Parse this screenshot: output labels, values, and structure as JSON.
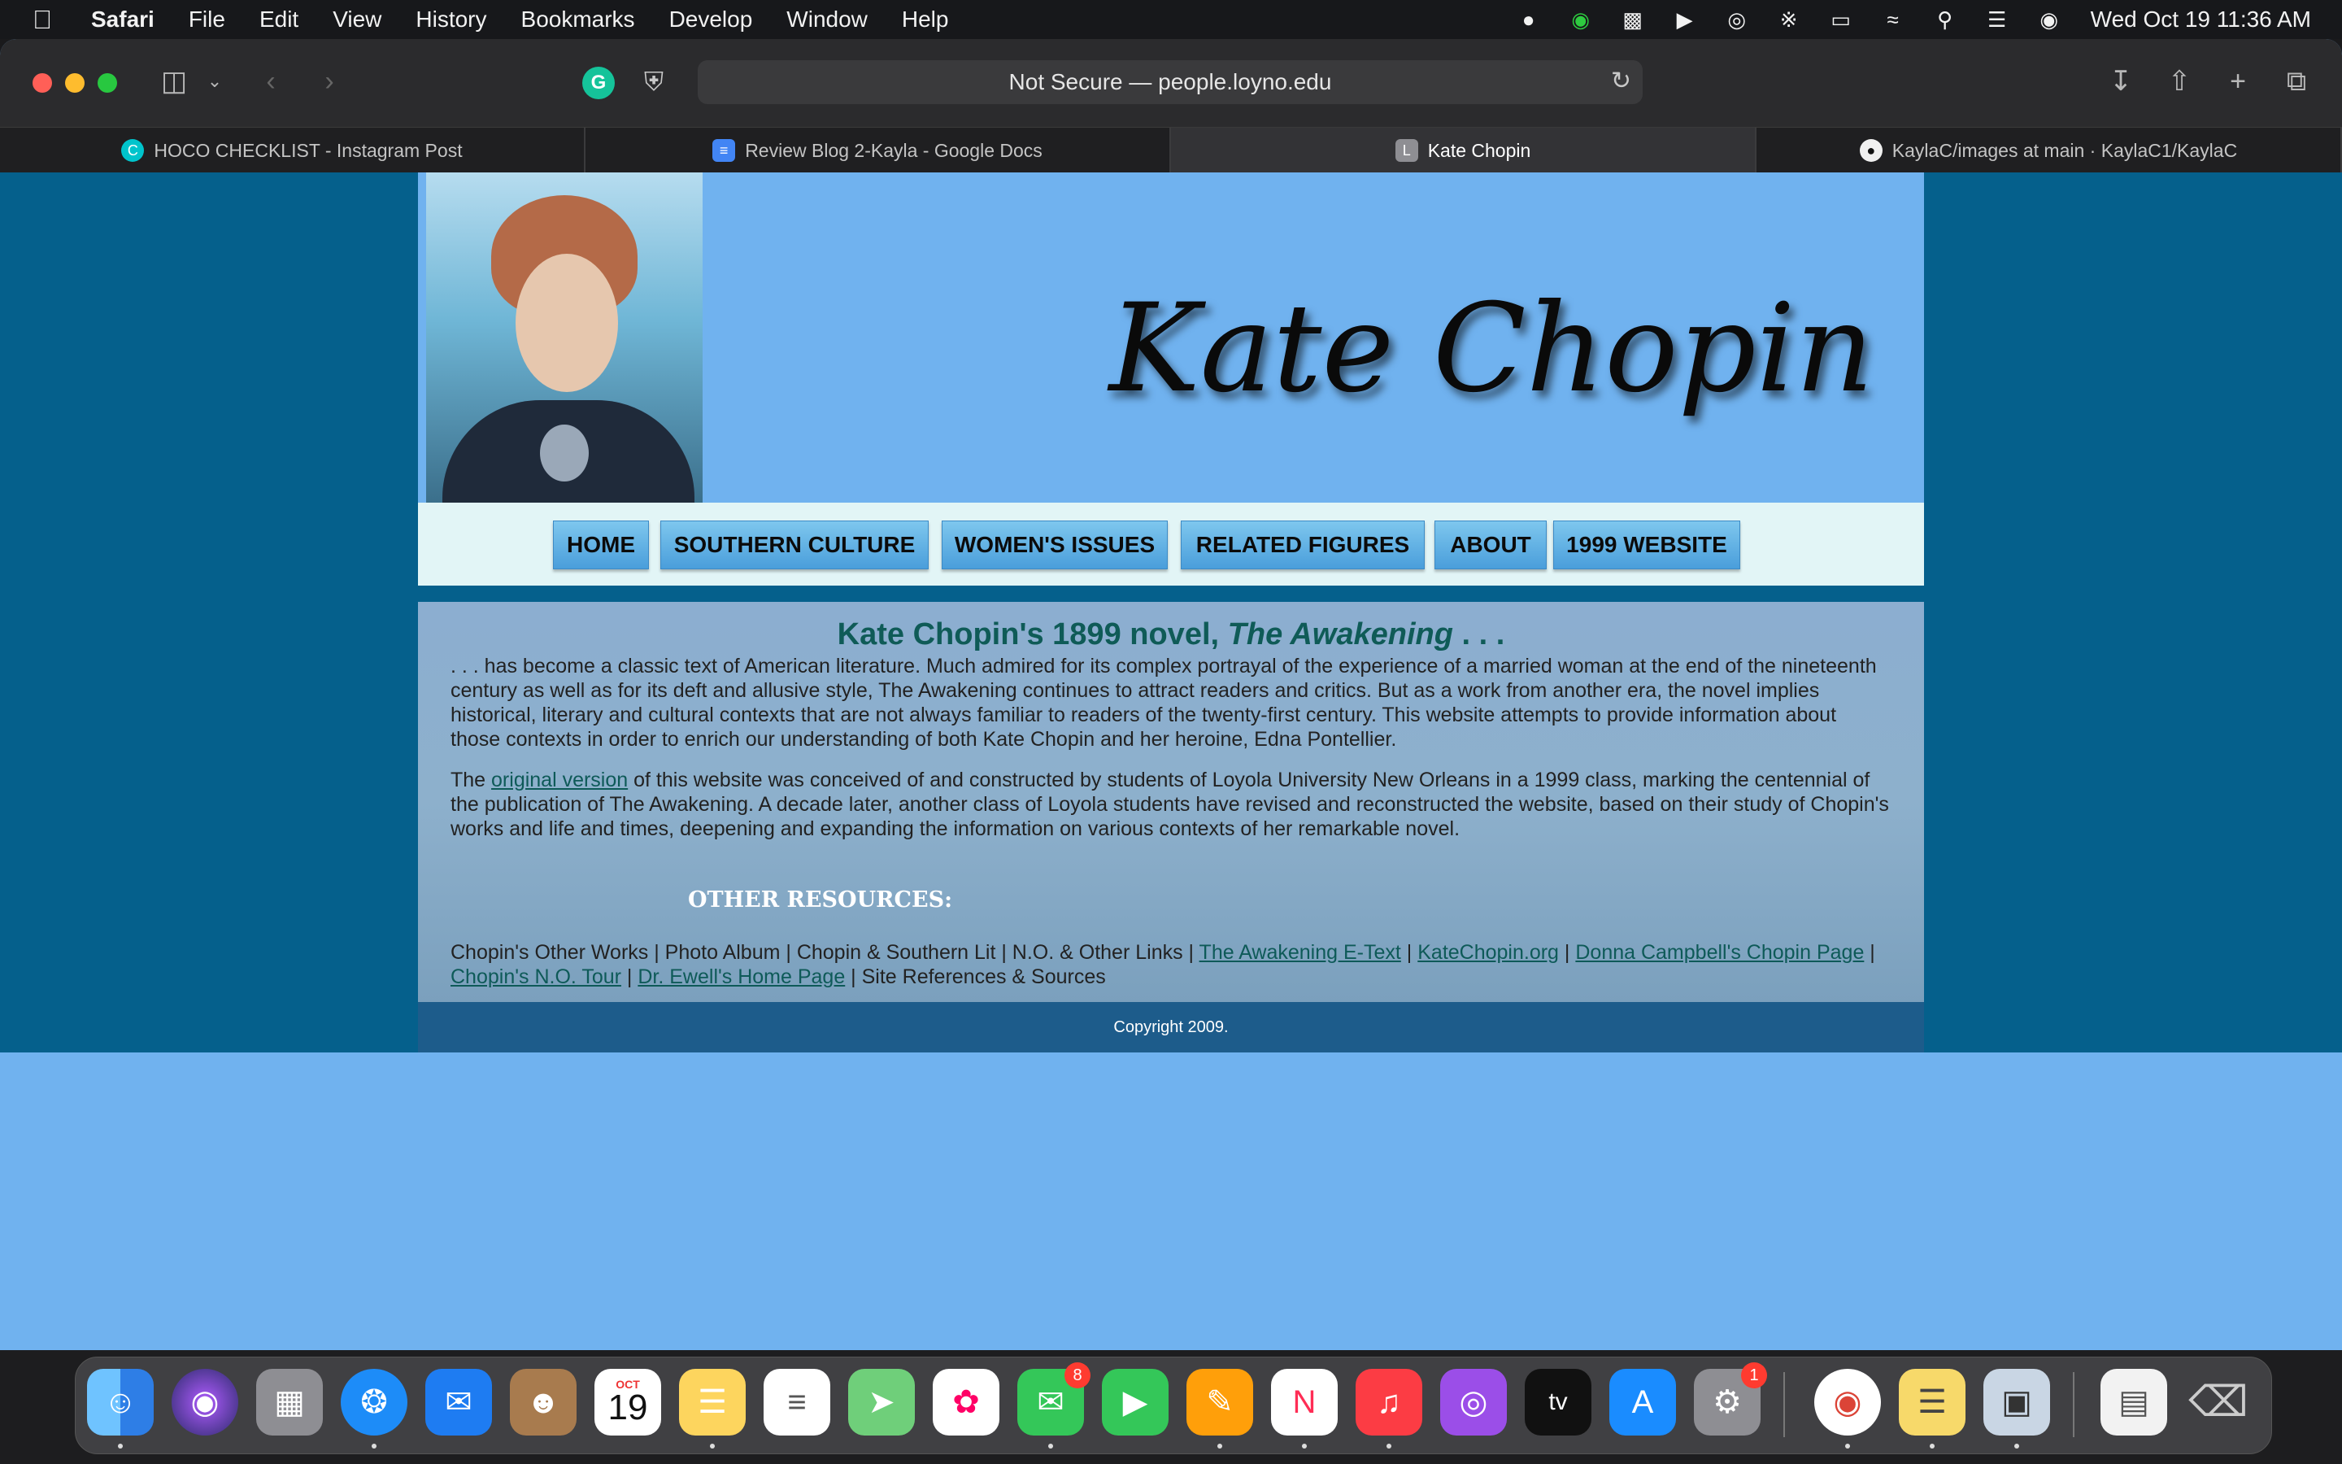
{
  "menubar": {
    "app": "Safari",
    "items": [
      "File",
      "Edit",
      "View",
      "History",
      "Bookmarks",
      "Develop",
      "Window",
      "Help"
    ],
    "clock": "Wed Oct 19  11:36 AM"
  },
  "browser": {
    "url_text": "Not Secure — people.loyno.edu",
    "tabs": [
      {
        "label": "HOCO CHECKLIST - Instagram Post",
        "icon": "canva-icon"
      },
      {
        "label": "Review Blog 2-Kayla - Google Docs",
        "icon": "google-docs-icon"
      },
      {
        "label": "Kate Chopin",
        "icon": "letter-l-icon"
      },
      {
        "label": "KaylaC/images at main · KaylaC1/KaylaC",
        "icon": "github-icon"
      }
    ]
  },
  "site": {
    "title": "Kate Chopin",
    "nav": [
      "HOME",
      "SOUTHERN CULTURE",
      "WOMEN'S ISSUES",
      "RELATED FIGURES",
      "ABOUT",
      "1999 WEBSITE"
    ],
    "headline_prefix": "Kate Chopin's 1899 novel, ",
    "headline_italic": "The Awakening",
    "headline_suffix": " . . .",
    "para1": ". . . has become a classic text of American literature. Much admired for its complex portrayal of the experience of a married woman at the end of the nineteenth century as well as for its deft and allusive style, The Awakening continues to attract readers and critics. But as a work from another era, the novel implies historical, literary and cultural contexts that are not always familiar to readers of the twenty-first century. This website attempts to provide information about those contexts in order to enrich our understanding of both Kate Chopin and her heroine, Edna Pontellier.",
    "para2_prefix": "The ",
    "para2_link": "original version",
    "para2_rest": " of this website was conceived of and constructed by students of Loyola University New Orleans in a 1999 class, marking the centennial of the publication of The Awakening. A decade later, another class of Loyola students have revised and reconstructed the website, based on their study of Chopin's works and life and times, deepening and expanding the information on various contexts of her remarkable novel.",
    "resources_title": "OTHER RESOURCES:",
    "resources_plain_1": "Chopin's Other Works | Photo Album | Chopin & Southern Lit | N.O. & Other Links | ",
    "resources_link_1": "The Awakening E-Text",
    "resources_link_2": "KateChopin.org",
    "resources_link_3": "Donna Campbell's Chopin Page",
    "resources_link_4": "Chopin's N.O. Tour",
    "resources_link_5": "Dr. Ewell's Home Page",
    "resources_plain_2": " | Site References & Sources",
    "sep": " | ",
    "copyright": "Copyright 2009."
  },
  "dock": {
    "calendar_month": "OCT",
    "calendar_day": "19",
    "messages_badge": "8",
    "settings_badge": "1",
    "tv_label": "tv"
  }
}
